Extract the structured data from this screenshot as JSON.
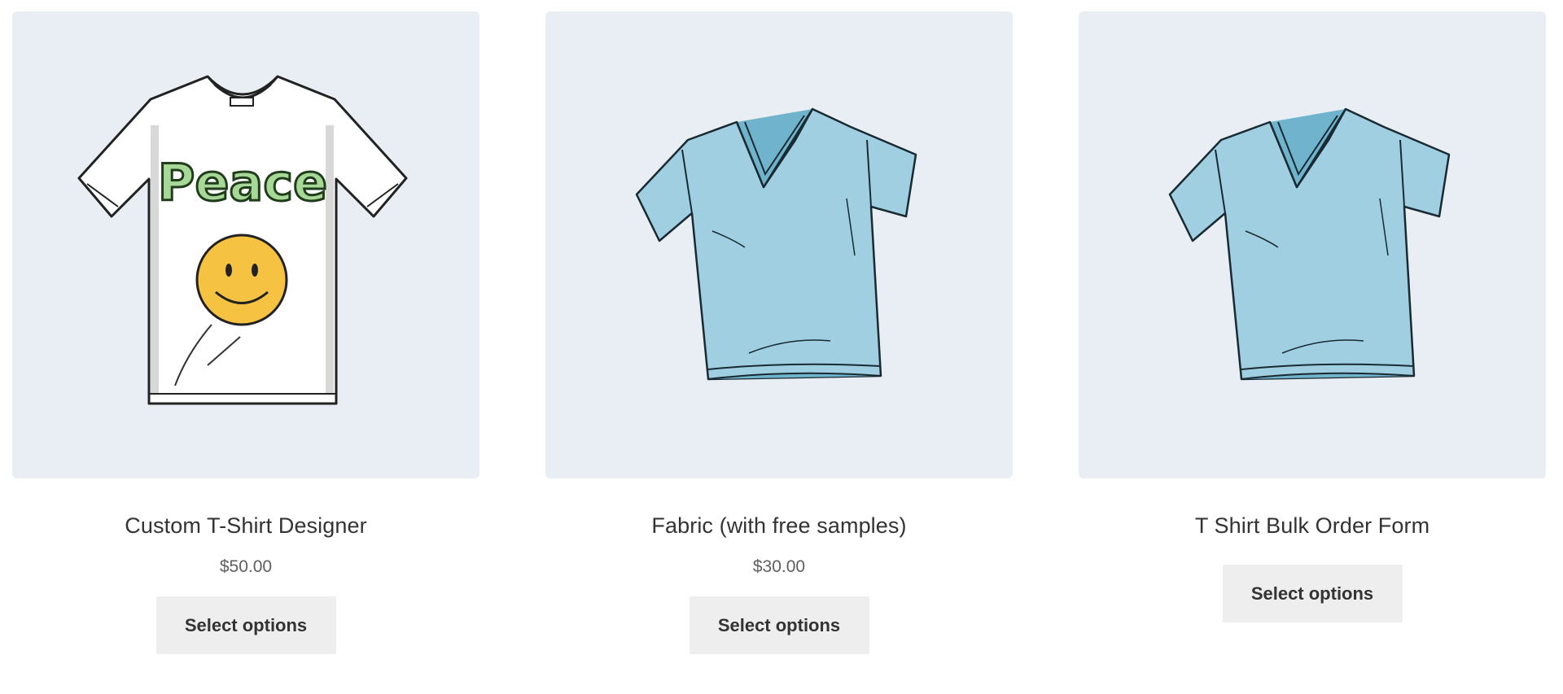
{
  "products": [
    {
      "title": "Custom T-Shirt Designer",
      "price": "$50.00",
      "button_label": "Select options",
      "image_icon": "white-peace-tshirt-image",
      "shirt_text": "Peace"
    },
    {
      "title": "Fabric (with free samples)",
      "price": "$30.00",
      "button_label": "Select options",
      "image_icon": "blue-vneck-tshirt-image"
    },
    {
      "title": "T Shirt Bulk Order Form",
      "button_label": "Select options",
      "image_icon": "blue-vneck-tshirt-image"
    }
  ],
  "colors": {
    "thumb_bg": "#e8eef3",
    "button_bg": "#eeeeee",
    "text": "#333333",
    "price_text": "#5f5f5f",
    "shirt_blue": "#9fcfe0",
    "peace_green": "#a8d898",
    "smiley_yellow": "#f5c242"
  }
}
